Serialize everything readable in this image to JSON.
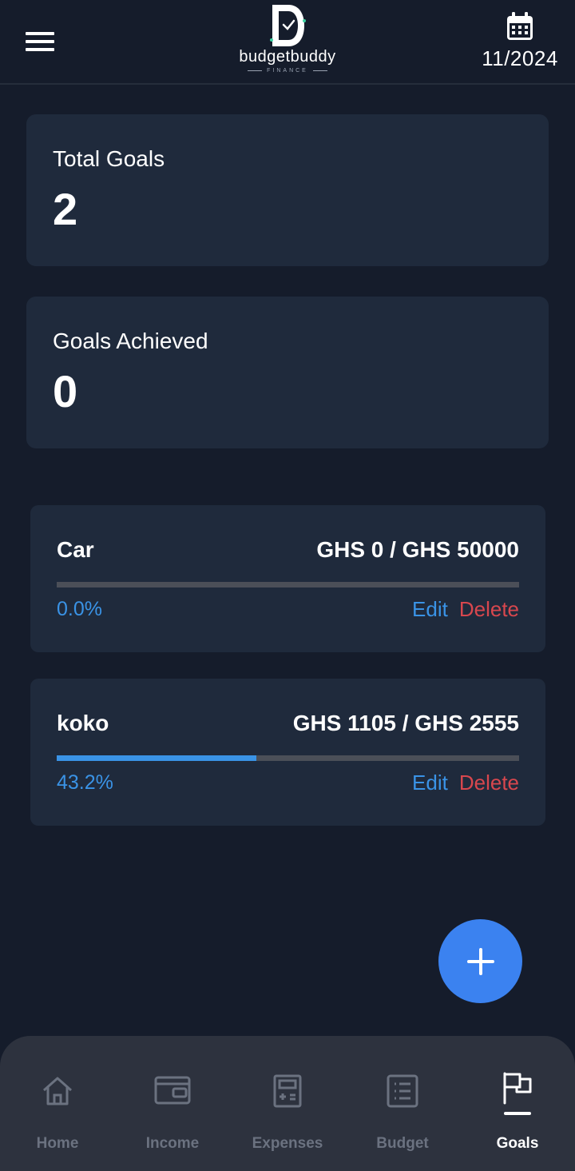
{
  "header": {
    "logo_name": "budgetbuddy",
    "logo_sub": "FINANCE",
    "date": "11/2024"
  },
  "stats": {
    "total_goals_label": "Total Goals",
    "total_goals_value": "2",
    "achieved_label": "Goals Achieved",
    "achieved_value": "0"
  },
  "goals": [
    {
      "name": "Car",
      "amount": "GHS 0 / GHS 50000",
      "percent": "0.0%",
      "progress": 0.0,
      "edit": "Edit",
      "delete": "Delete"
    },
    {
      "name": "koko",
      "amount": "GHS 1105 / GHS 2555",
      "percent": "43.2%",
      "progress": 0.432,
      "edit": "Edit",
      "delete": "Delete"
    }
  ],
  "nav": {
    "items": [
      {
        "label": "Home",
        "icon": "home-icon"
      },
      {
        "label": "Income",
        "icon": "wallet-icon"
      },
      {
        "label": "Expenses",
        "icon": "calculator-icon"
      },
      {
        "label": "Budget",
        "icon": "list-icon"
      },
      {
        "label": "Goals",
        "icon": "flag-icon"
      }
    ],
    "active": "Goals"
  },
  "colors": {
    "background": "#151c2b",
    "card": "#1f2a3c",
    "accent": "#3a93e6",
    "danger": "#d8474e",
    "fab": "#3b82f0"
  }
}
